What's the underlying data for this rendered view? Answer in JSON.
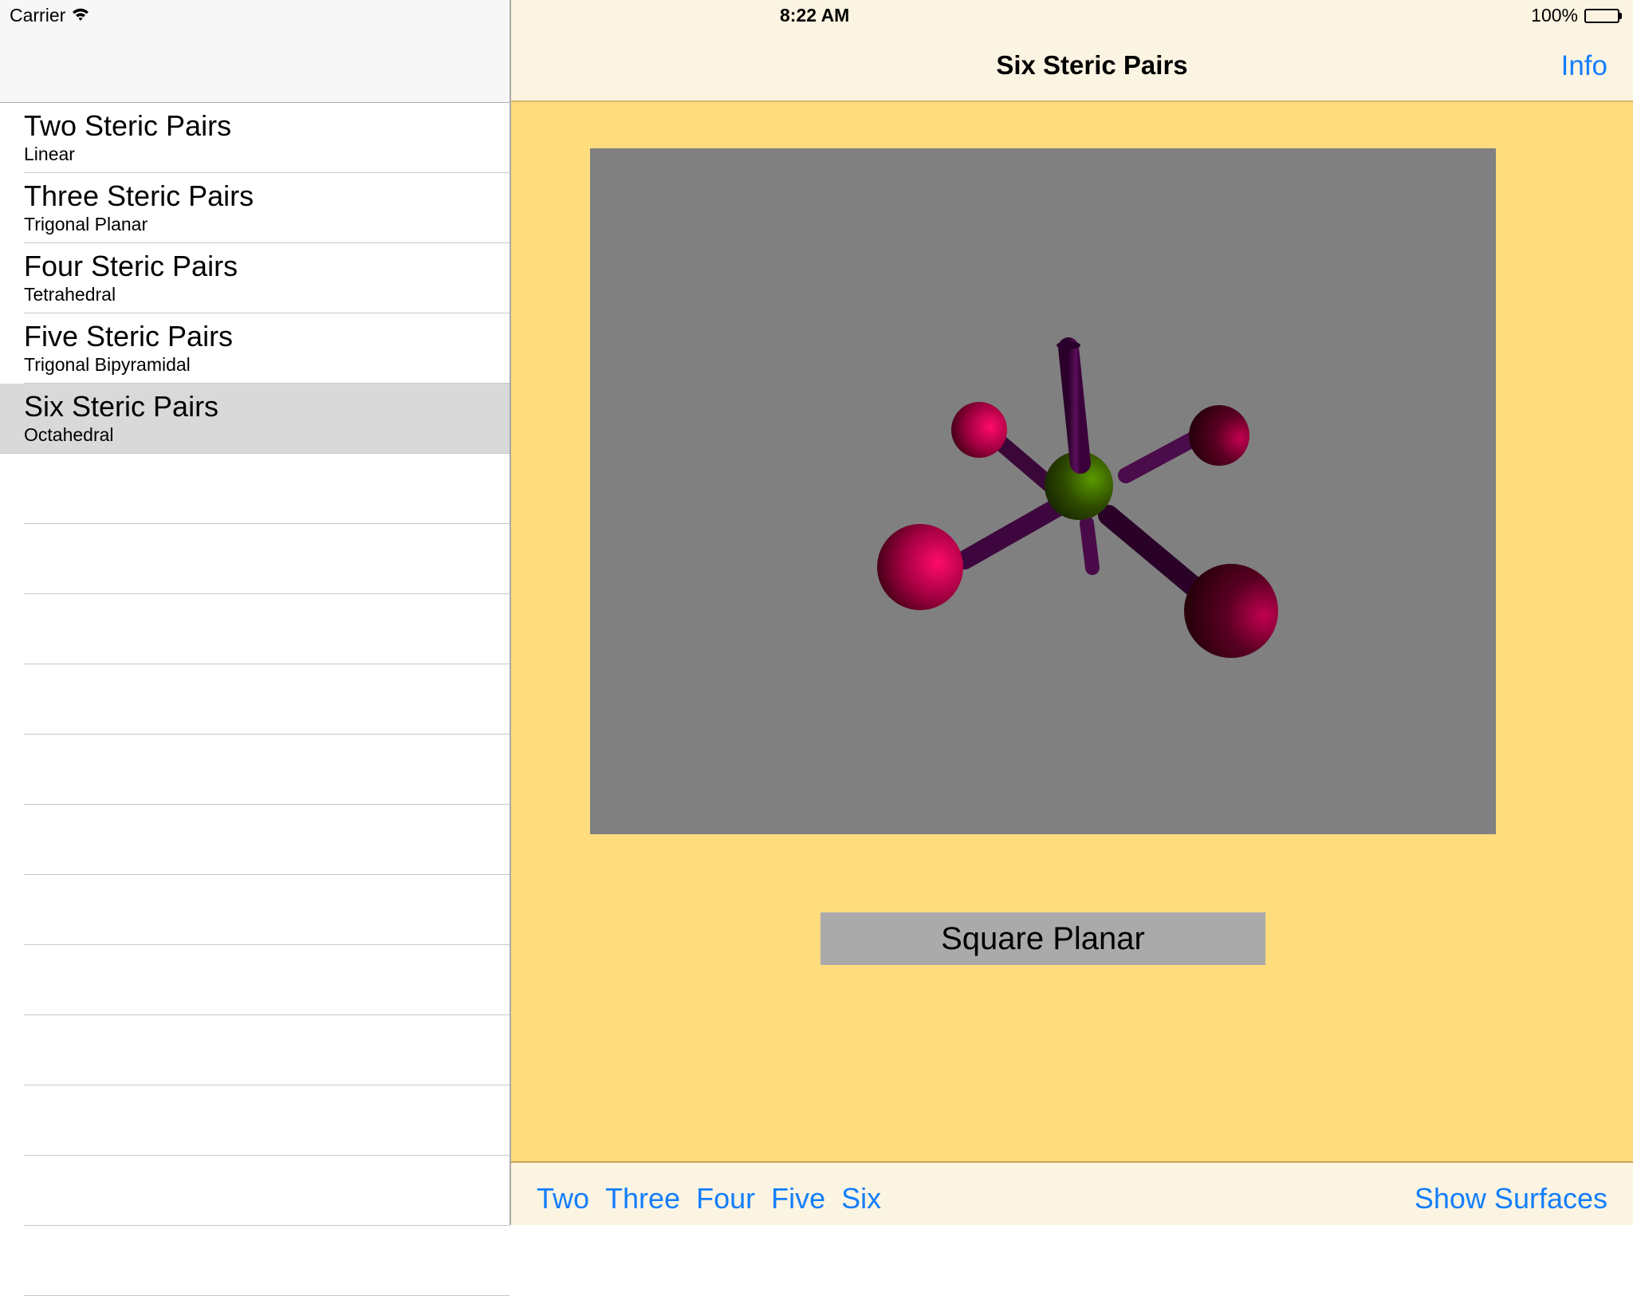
{
  "status_bar": {
    "carrier": "Carrier",
    "time": "8:22 AM",
    "battery": "100%",
    "battery_level": 1.0
  },
  "sidebar": {
    "items": [
      {
        "title": "Two Steric Pairs",
        "subtitle": "Linear",
        "selected": false
      },
      {
        "title": "Three Steric Pairs",
        "subtitle": "Trigonal Planar",
        "selected": false
      },
      {
        "title": "Four Steric Pairs",
        "subtitle": "Tetrahedral",
        "selected": false
      },
      {
        "title": "Five Steric Pairs",
        "subtitle": "Trigonal Bipyramidal",
        "selected": false
      },
      {
        "title": "Six Steric Pairs",
        "subtitle": "Octahedral",
        "selected": true
      }
    ]
  },
  "navbar": {
    "title": "Six Steric Pairs",
    "info_label": "Info"
  },
  "viewer": {
    "molecule_geometry": "octahedral",
    "central_atom_color": "#4a7a00",
    "ligand_color": "#e0005a",
    "bond_color": "#4a0a4a",
    "background_color": "#808080"
  },
  "shape_button": {
    "label": "Square Planar"
  },
  "toolbar": {
    "items": [
      "Two",
      "Three",
      "Four",
      "Five",
      "Six"
    ],
    "show_surfaces_label": "Show Surfaces"
  },
  "colors": {
    "accent": "#147efb",
    "main_background": "#ffdc7e",
    "bar_background": "#fcf4e2",
    "selected_row": "#d9d9d9"
  }
}
